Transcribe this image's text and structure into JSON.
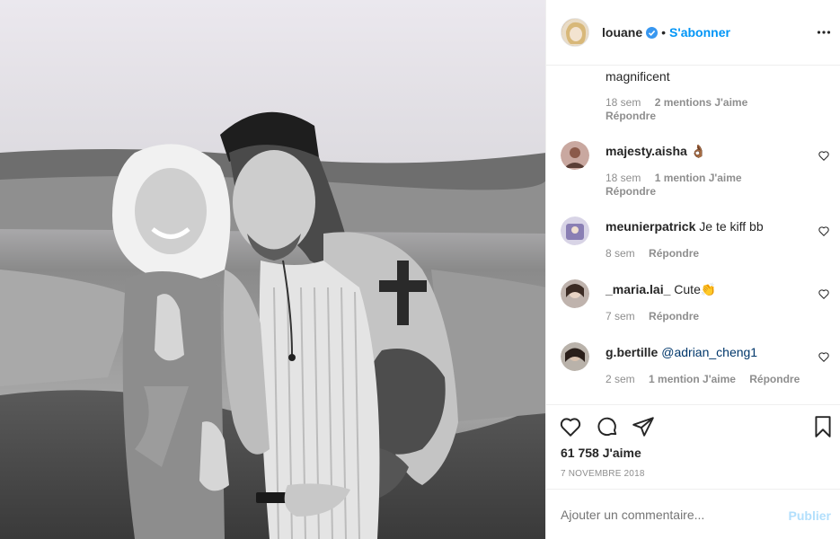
{
  "post": {
    "image_alt": "Black and white photo of a smiling woman with blonde hair giving thumbs up next to a tattooed man in a cap and tank top"
  },
  "header": {
    "username": "louane",
    "separator": "•",
    "follow_label": "S'abonner",
    "more_icon": "ellipsis-icon"
  },
  "comments": [
    {
      "user": "",
      "text": "magnificent",
      "time": "18 sem",
      "likes": "2 mentions J'aime",
      "reply": "Répondre"
    },
    {
      "user": "majesty.aisha",
      "text": "👌🏾",
      "time": "18 sem",
      "likes": "1 mention J'aime",
      "reply": "Répondre"
    },
    {
      "user": "meunierpatrick",
      "text": "Je te kiff bb",
      "time": "8 sem",
      "likes": "",
      "reply": "Répondre"
    },
    {
      "user": "_maria.lai_",
      "text": "Cute👏",
      "time": "7 sem",
      "likes": "",
      "reply": "Répondre"
    },
    {
      "user": "g.bertille",
      "text": "@adrian_cheng1",
      "time": "2 sem",
      "likes": "1 mention J'aime",
      "reply": "Répondre"
    }
  ],
  "actions": {
    "likes_count": "61 758",
    "likes_label": "J'aime",
    "date": "7 NOVEMBRE 2018"
  },
  "add_comment": {
    "placeholder": "Ajouter un commentaire...",
    "publish_label": "Publier"
  },
  "colors": {
    "accent": "#0095f6",
    "muted": "#8e8e8e",
    "border": "#efefef"
  }
}
